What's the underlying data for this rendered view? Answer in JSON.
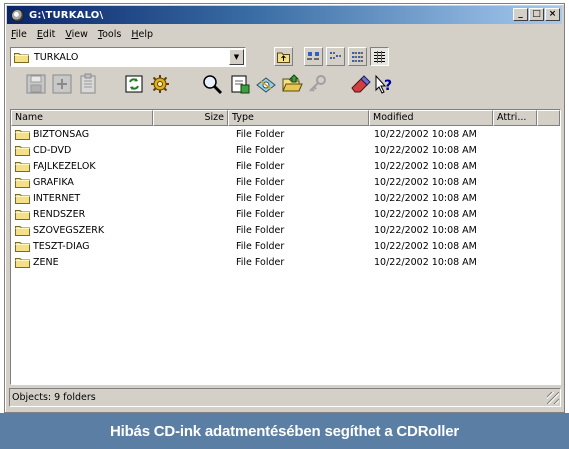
{
  "window": {
    "title": "G:\\TURKALO\\",
    "buttons": {
      "minimize": "_",
      "maximize": "□",
      "close": "×"
    }
  },
  "menu": [
    "File",
    "Edit",
    "View",
    "Tools",
    "Help"
  ],
  "address": {
    "value": "TURKALO"
  },
  "list": {
    "columns": {
      "name": "Name",
      "size": "Size",
      "type": "Type",
      "modified": "Modified",
      "attributes": "Attri..."
    },
    "rows": [
      {
        "name": "BIZTONSAG",
        "size": "",
        "type": "File Folder",
        "modified": "10/22/2002 10:08 AM"
      },
      {
        "name": "CD-DVD",
        "size": "",
        "type": "File Folder",
        "modified": "10/22/2002 10:08 AM"
      },
      {
        "name": "FAJLKEZELOK",
        "size": "",
        "type": "File Folder",
        "modified": "10/22/2002 10:08 AM"
      },
      {
        "name": "GRAFIKA",
        "size": "",
        "type": "File Folder",
        "modified": "10/22/2002 10:08 AM"
      },
      {
        "name": "INTERNET",
        "size": "",
        "type": "File Folder",
        "modified": "10/22/2002 10:08 AM"
      },
      {
        "name": "RENDSZER",
        "size": "",
        "type": "File Folder",
        "modified": "10/22/2002 10:08 AM"
      },
      {
        "name": "SZOVEGSZERK",
        "size": "",
        "type": "File Folder",
        "modified": "10/22/2002 10:08 AM"
      },
      {
        "name": "TESZT-DIAG",
        "size": "",
        "type": "File Folder",
        "modified": "10/22/2002 10:08 AM"
      },
      {
        "name": "ZENE",
        "size": "",
        "type": "File Folder",
        "modified": "10/22/2002 10:08 AM"
      }
    ]
  },
  "status": {
    "text": "Objects: 9 folders"
  },
  "caption": {
    "text": "Hibás CD-ink adatmentésében segíthet a CDRoller"
  },
  "colors": {
    "titlebar_start": "#0a246a",
    "titlebar_end": "#a6caf0",
    "face": "#d4d0c8",
    "caption_bg": "#5b7ea4",
    "folder": "#f5e08a"
  },
  "icons": [
    "app-icon",
    "folder-icon",
    "up-folder-icon",
    "large-icons-icon",
    "small-icons-icon",
    "list-view-icon",
    "details-view-icon",
    "save-icon",
    "new-icon",
    "properties-icon",
    "refresh-icon",
    "settings-icon",
    "search-icon",
    "extract-icon",
    "disc-icon",
    "open-folder-icon",
    "key-icon",
    "eraser-icon",
    "help-icon",
    "size-grip-icon"
  ]
}
